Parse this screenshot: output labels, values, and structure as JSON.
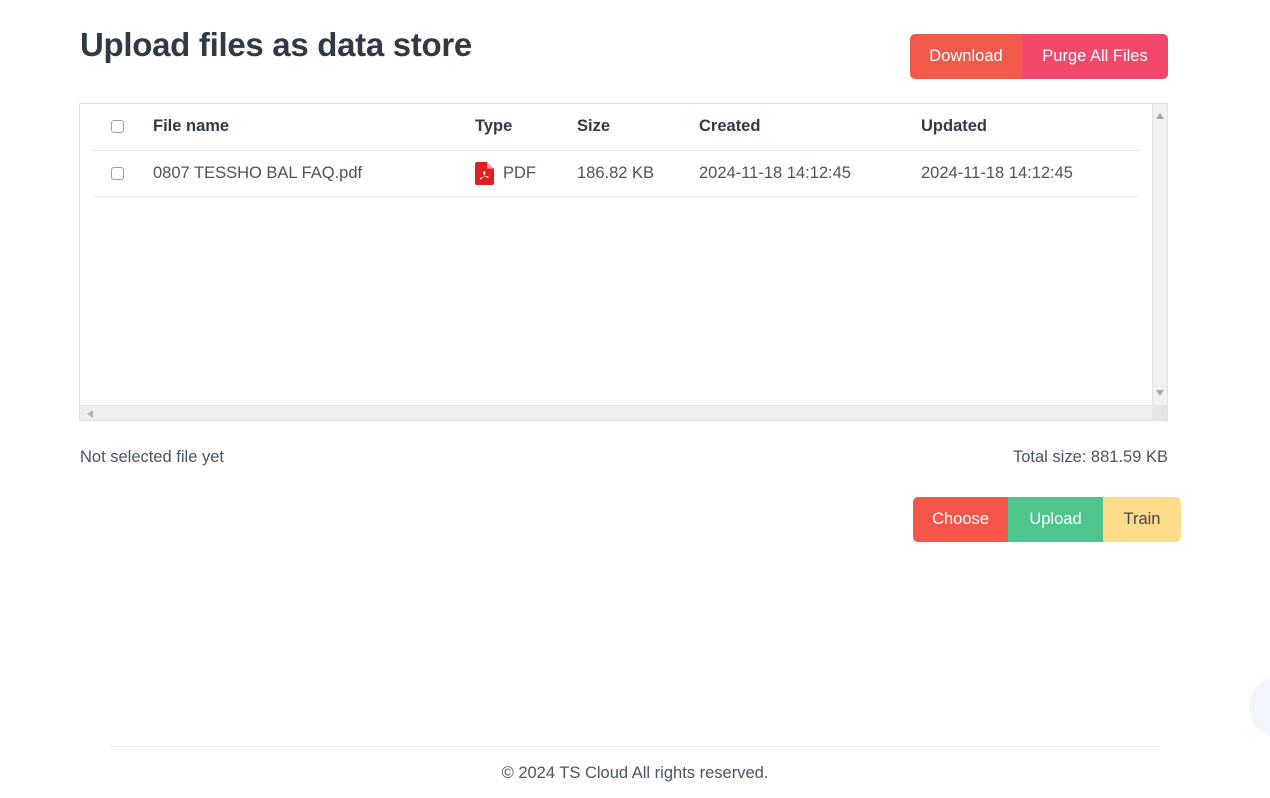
{
  "header": {
    "title": "Upload files as data store",
    "download_label": "Download",
    "purge_label": "Purge All Files"
  },
  "table": {
    "columns": {
      "select": "",
      "file_name": "File name",
      "type": "Type",
      "size": "Size",
      "created": "Created",
      "updated": "Updated"
    },
    "rows": [
      {
        "file_name": "0807 TESSHO BAL FAQ.pdf",
        "type": "PDF",
        "type_icon": "pdf-file-icon",
        "size": "186.82 KB",
        "created": "2024-11-18 14:12:45",
        "updated": "2024-11-18 14:12:45"
      }
    ]
  },
  "status": {
    "selection": "Not selected file yet",
    "total_size": "Total size: 881.59 KB"
  },
  "actions": {
    "choose_label": "Choose",
    "upload_label": "Upload",
    "train_label": "Train"
  },
  "footer": {
    "copyright": "© 2024 TS Cloud All rights reserved."
  },
  "colors": {
    "download": "#f1594a",
    "purge": "#f2486c",
    "choose": "#f4564a",
    "upload": "#4ec58d",
    "train": "#fcdc8b",
    "pdf_icon": "#e02020",
    "text": "#4a5460",
    "heading": "#2f3a45"
  }
}
